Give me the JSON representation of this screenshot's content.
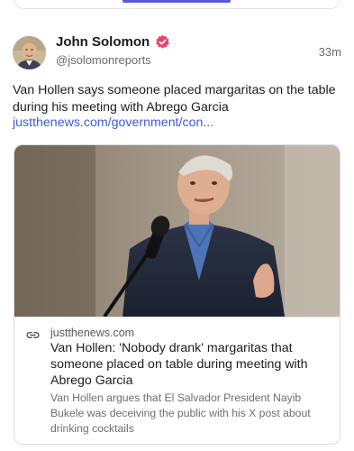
{
  "post": {
    "author_name": "John Solomon",
    "author_handle": "@jsolomonreports",
    "timestamp": "33m",
    "text": "Van Hollen says someone placed margaritas on the table during his meeting with Abrego Garcia",
    "link_text": "justthenews.com/government/con..."
  },
  "embed": {
    "domain": "justthenews.com",
    "title": "Van Hollen: 'Nobody drank' margaritas that someone placed on table during meeting with Abrego Garcia",
    "description": "Van Hollen argues that El Salvador President Nayib Bukele was deceiving the public with his X post about drinking cocktails"
  },
  "colors": {
    "accent": "#5b57d9",
    "link": "#3b5bdb",
    "verified_badge": "#e9436b"
  },
  "icons": {
    "verified": "verified-badge-icon",
    "link": "link-icon"
  }
}
